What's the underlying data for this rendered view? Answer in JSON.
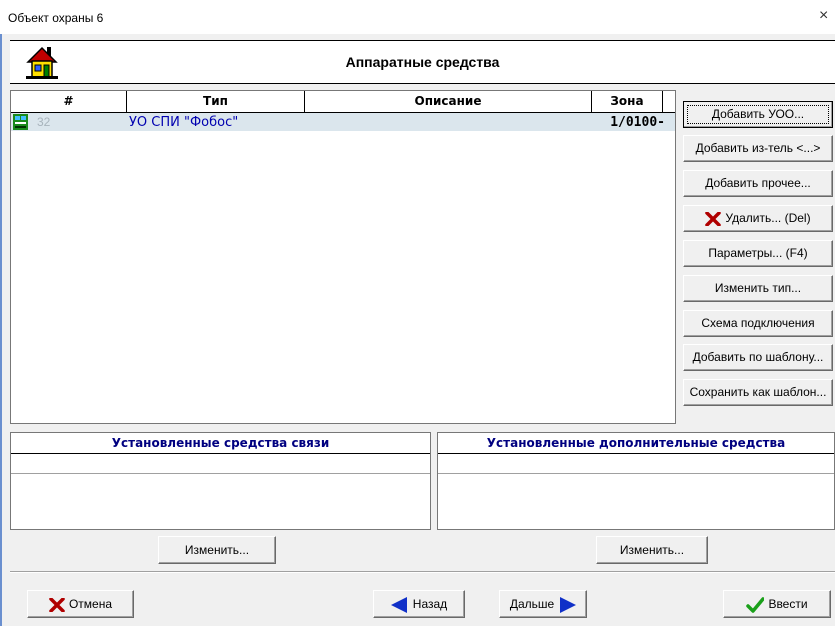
{
  "window": {
    "title": "Объект охраны 6",
    "close_glyph": "×"
  },
  "header": {
    "title": "Аппаратные средства",
    "icon": "house-icon"
  },
  "grid": {
    "columns": [
      "#",
      "Тип",
      "Описание",
      "Зона"
    ],
    "rows": [
      {
        "num": "32",
        "type": "УО СПИ \"Фобос\"",
        "description": "",
        "zone": "1/0100-",
        "icon": "device-icon"
      }
    ]
  },
  "side_buttons": {
    "add_uoo": "Добавить УОО...",
    "add_meter": "Добавить из-тель <...>",
    "add_other": "Добавить прочее...",
    "delete": "Удалить... (Del)",
    "params": "Параметры... (F4)",
    "change_type": "Изменить тип...",
    "wiring": "Схема подключения",
    "add_template": "Добавить по шаблону...",
    "save_template": "Сохранить как шаблон..."
  },
  "panels": {
    "comm": {
      "title": "Установленные средства связи",
      "button": "Изменить..."
    },
    "extra": {
      "title": "Установленные дополнительные средства",
      "button": "Изменить..."
    }
  },
  "footer": {
    "cancel": "Отмена",
    "back": "Назад",
    "next": "Дальше",
    "enter": "Ввести"
  },
  "colors": {
    "row_highlight": "#dbe6ed",
    "type_text": "#0000b0",
    "panel_title": "#000080",
    "ok_green": "#1aa01a",
    "cancel_red": "#b00000",
    "arrow_blue": "#1030c8"
  }
}
